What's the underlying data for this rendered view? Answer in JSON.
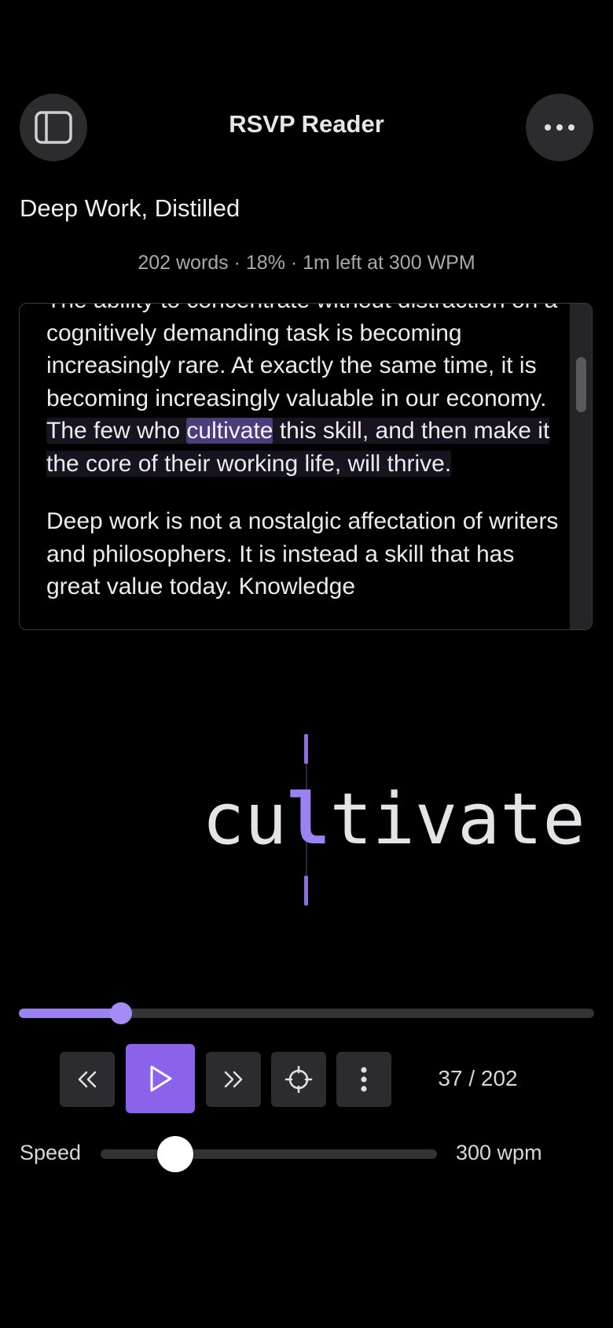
{
  "header": {
    "title": "RSVP Reader",
    "left_button_icon": "sidebar-toggle-icon",
    "right_button_icon": "more-horizontal-icon"
  },
  "document": {
    "title": "Deep Work, Distilled",
    "stats": "202 words · 18% · 1m left at 300 WPM"
  },
  "text_panel": {
    "p1_before": "The ability to concentrate without distraction on a cognitively demanding task is becoming increasingly rare. At exactly the same time, it is becoming increasingly valuable in our economy. ",
    "p1_sentence_start": "The few who ",
    "p1_current_word": "cultivate",
    "p1_sentence_end": " this skill, and then make it the core of their working life, will thrive.",
    "p2": "Deep work is not a nostalgic affectation of writers and philosophers. It is instead a skill that has great value today. Knowledge"
  },
  "rsvp": {
    "word_before": "cu",
    "word_orp": "l",
    "word_after": "tivate"
  },
  "progress": {
    "current": 37,
    "total": 202,
    "fraction": 0.178
  },
  "controls": {
    "rewind_icon": "rewind-icon",
    "play_icon": "play-icon",
    "forward_icon": "fast-forward-icon",
    "focus_icon": "crosshair-icon",
    "more_icon": "more-vertical-icon",
    "counter": "37 / 202"
  },
  "speed": {
    "label": "Speed",
    "value": "300 wpm",
    "wpm": 300,
    "min": 100,
    "max": 1000
  },
  "colors": {
    "accent": "#8b62ea",
    "accent_light": "#9b82f0",
    "background": "#000000",
    "button_bg": "#2c2c2e"
  }
}
